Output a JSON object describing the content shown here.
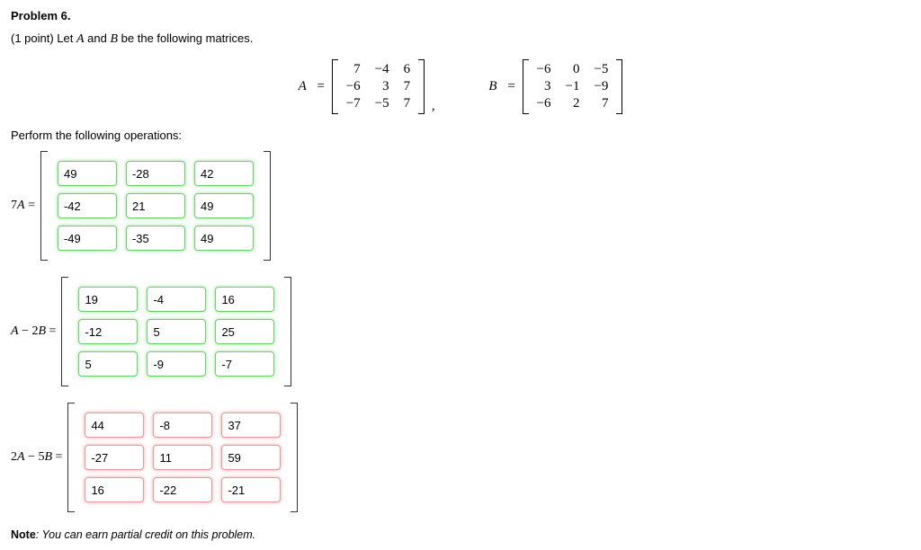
{
  "title": "Problem 6.",
  "points_prefix": "(1 point) Let ",
  "let_A": "A",
  "let_and": " and ",
  "let_B": "B",
  "let_suffix": " be the following matrices.",
  "perform": "Perform the following operations:",
  "matrix_A_label": "A",
  "matrix_B_label": "B",
  "eq": "=",
  "comma": ",",
  "A": [
    [
      "7",
      "−4",
      "6"
    ],
    [
      "−6",
      "3",
      "7"
    ],
    [
      "−7",
      "−5",
      "7"
    ]
  ],
  "B": [
    [
      "−6",
      "0",
      "−5"
    ],
    [
      "3",
      "−1",
      "−9"
    ],
    [
      "−6",
      "2",
      "7"
    ]
  ],
  "answers": [
    {
      "label_html": "7<span class='it'>A</span> =",
      "status": "correct",
      "cells": [
        [
          "49",
          "-28",
          "42"
        ],
        [
          "-42",
          "21",
          "49"
        ],
        [
          "-49",
          "-35",
          "49"
        ]
      ]
    },
    {
      "label_html": "<span class='it'>A</span> − 2<span class='it'>B</span> =",
      "status": "correct",
      "cells": [
        [
          "19",
          "-4",
          "16"
        ],
        [
          "-12",
          "5",
          "25"
        ],
        [
          "5",
          "-9",
          "-7"
        ]
      ]
    },
    {
      "label_html": "2<span class='it'>A</span> − 5<span class='it'>B</span> =",
      "status": "incorrect",
      "cells": [
        [
          "44",
          "-8",
          "37"
        ],
        [
          "-27",
          "11",
          "59"
        ],
        [
          "16",
          "-22",
          "-21"
        ]
      ]
    }
  ],
  "note_bold": "Note",
  "note_text": ": You can earn partial credit on this problem."
}
